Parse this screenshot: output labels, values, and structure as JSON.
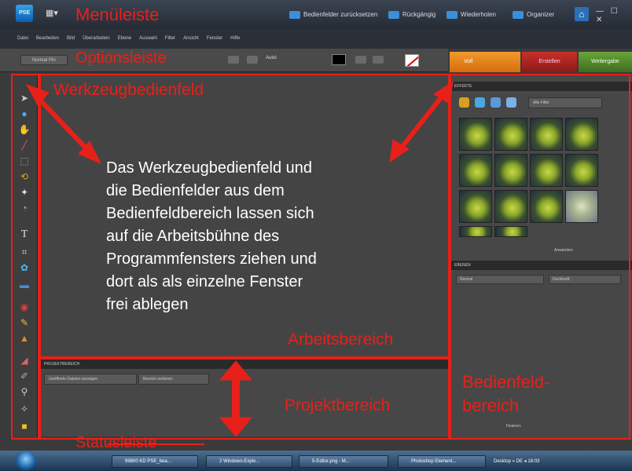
{
  "titlebar": {
    "logo": "PSE",
    "buttons": [
      "Bedienfelder zurücksetzen",
      "Rückgängig",
      "Wiederholen",
      "Organizer"
    ],
    "window_controls": "— ☐ ✕"
  },
  "menu": [
    "Datei",
    "Bearbeiten",
    "Bild",
    "Überarbeiten",
    "Ebene",
    "Auswahl",
    "Filter",
    "Ansicht",
    "Fenster",
    "Hilfe"
  ],
  "options": {
    "tool_preset": "Normal Pin",
    "auto_label": "Autol"
  },
  "panel_tabs": {
    "voll": "Voll",
    "erstellen": "Erstellen",
    "weitergabe": "Weitergabe"
  },
  "effects": {
    "header": "EFFEKTE",
    "filter": "Alle Filter",
    "footer": "Anwenden"
  },
  "layers": {
    "header": "EBENEN",
    "blend_mode": "Normal",
    "opacity": "Deckkraft:",
    "footer": "Fixieren:"
  },
  "project": {
    "header": "PROJEKTBEREICH",
    "select": "Geöffnete Dateien anzeigen",
    "select2": "Bereich sortieren"
  },
  "annotation": {
    "line1": "Das Werkzeugbedienfeld und",
    "line2": "die Bedienfelder aus dem",
    "line3": "Bedienfeldbereich lassen sich",
    "line4": "auf die Arbeitsbühne des",
    "line5": "Programmfensters ziehen und",
    "line6": "dort als als einzelne Fenster",
    "line7": "frei ablegen"
  },
  "labels": {
    "menuleiste": "Menüleiste",
    "optionsleiste": "Optionsleiste",
    "werkzeug": "Werkzeugbedienfeld",
    "arbeitsbereich": "Arbeitsbereich",
    "projektbereich": "Projektbereich",
    "bedienfeld1": "Bedienfeld-",
    "bedienfeld2": "bereich",
    "statusleiste": "Statusleiste"
  },
  "taskbar": {
    "items": [
      "99800 KD PSE_bea...",
      "2 Windows-Explo...",
      "5-Editor.png - M...",
      "Photoshop Element..."
    ],
    "tray": "Desktop  «  DE  ◂  18:03"
  },
  "colors": {
    "annotation_red": "#e8201a",
    "voll_tab": "#e8821e",
    "erstellen_tab": "#b02a24",
    "weitergabe_tab": "#5a9232"
  }
}
